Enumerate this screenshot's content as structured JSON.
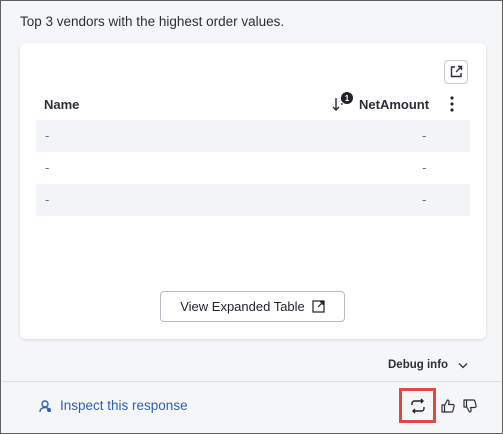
{
  "intro_text": "Top 3 vendors with the highest order values.",
  "table": {
    "columns": [
      "Name",
      "NetAmount"
    ],
    "sort_badge": "1",
    "rows": [
      {
        "name": "-",
        "amount": "-"
      },
      {
        "name": "-",
        "amount": "-"
      },
      {
        "name": "-",
        "amount": "-"
      }
    ]
  },
  "expand_button_label": "View Expanded Table",
  "debug_label": "Debug info",
  "inspect_label": "Inspect this response",
  "icons": {
    "share": "share-icon",
    "sort": "sort-desc-icon",
    "kebab": "kebab-menu-icon",
    "expand": "open-external-icon",
    "chevron": "chevron-down-icon",
    "inspect": "inspect-bug-icon",
    "regenerate": "regenerate-icon",
    "thumb_up": "thumbs-up-icon",
    "thumb_down": "thumbs-down-icon"
  },
  "colors": {
    "link": "#2f5fb3",
    "highlight": "#e2483d",
    "cell_text": "#4b6ea8"
  }
}
